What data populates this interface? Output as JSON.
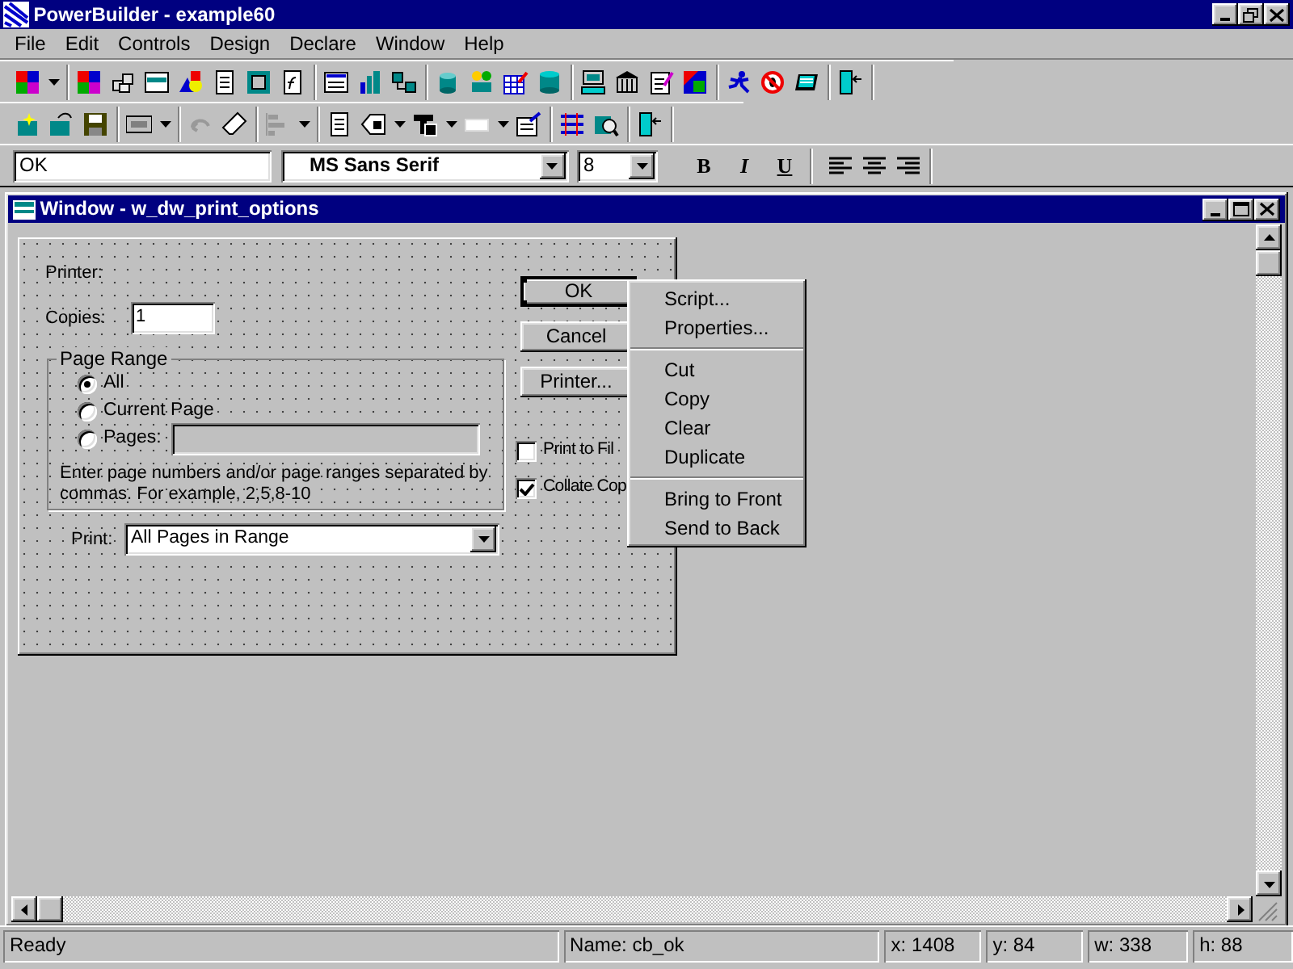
{
  "window": {
    "title": "PowerBuilder - example60"
  },
  "menu_bar": [
    {
      "label": "File"
    },
    {
      "label": "Edit"
    },
    {
      "label": "Controls"
    },
    {
      "label": "Design"
    },
    {
      "label": "Declare"
    },
    {
      "label": "Window"
    },
    {
      "label": "Help"
    }
  ],
  "style_bar": {
    "text_value": "OK",
    "font": "MS Sans Serif",
    "size": "8",
    "format_buttons": [
      {
        "label": "B",
        "kind": "bold"
      },
      {
        "label": "I",
        "kind": "italic"
      },
      {
        "label": "U",
        "kind": "underline"
      }
    ]
  },
  "child_window": {
    "title": "Window - w_dw_print_options"
  },
  "dialog": {
    "printer_label": "Printer:",
    "copies_label": "Copies:",
    "copies_value": "1",
    "page_range": {
      "title": "Page Range",
      "options": [
        {
          "label": "All",
          "selected": true
        },
        {
          "label": "Current Page",
          "selected": false
        },
        {
          "label": "Pages:",
          "selected": false
        }
      ],
      "hint": "Enter page numbers and/or page ranges separated by commas. For example, 2,5,8-10"
    },
    "print_label": "Print:",
    "print_value": "All Pages in Range",
    "buttons": [
      {
        "label": "OK",
        "selected": true
      },
      {
        "label": "Cancel",
        "selected": false
      },
      {
        "label": "Printer...",
        "selected": false
      }
    ],
    "checkboxes": [
      {
        "label": "Print to Fil",
        "checked": false
      },
      {
        "label": "Collate Cop",
        "checked": true
      }
    ]
  },
  "context_menu": {
    "groups": [
      [
        "Script...",
        "Properties..."
      ],
      [
        "Cut",
        "Copy",
        "Clear",
        "Duplicate"
      ],
      [
        "Bring to Front",
        "Send to Back"
      ]
    ]
  },
  "status_bar": [
    "Ready",
    "Name: cb_ok",
    "x: 1408",
    "y: 84",
    "w: 338",
    "h: 88"
  ]
}
